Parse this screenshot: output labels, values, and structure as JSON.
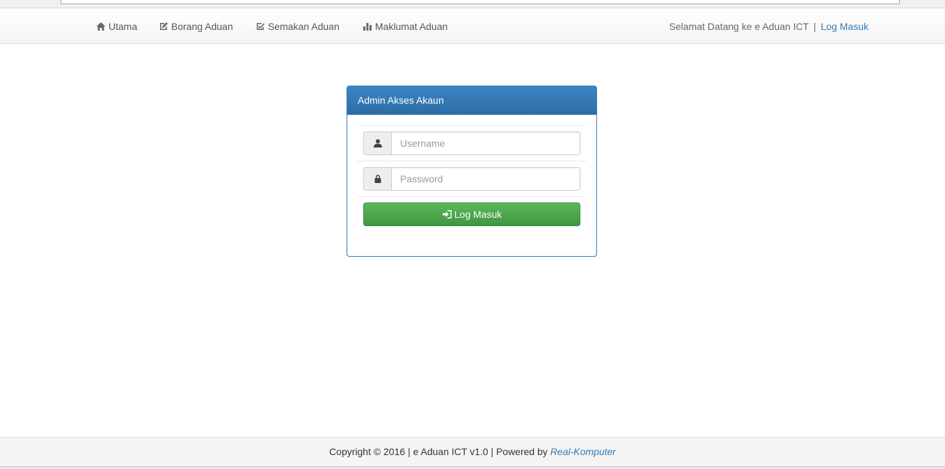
{
  "navbar": {
    "items": [
      {
        "label": "Utama",
        "icon": "home-icon"
      },
      {
        "label": "Borang Aduan",
        "icon": "edit-icon"
      },
      {
        "label": "Semakan Aduan",
        "icon": "check-square-icon"
      },
      {
        "label": "Maklumat Aduan",
        "icon": "bar-chart-icon"
      }
    ],
    "welcome_text": "Selamat Datang ke e Aduan ICT",
    "separator": "|",
    "login_link": "Log Masuk"
  },
  "login_panel": {
    "title": "Admin Akses Akaun",
    "username": {
      "placeholder": "Username",
      "value": "",
      "icon": "user-icon"
    },
    "password": {
      "placeholder": "Password",
      "value": "",
      "icon": "lock-icon"
    },
    "submit_label": "Log Masuk",
    "submit_icon": "log-in-icon"
  },
  "footer": {
    "text": "Copyright © 2016 | e Aduan ICT v1.0 | Powered by",
    "link": "Real-Komputer"
  },
  "colors": {
    "primary": "#337ab7",
    "success": "#5cb85c"
  }
}
